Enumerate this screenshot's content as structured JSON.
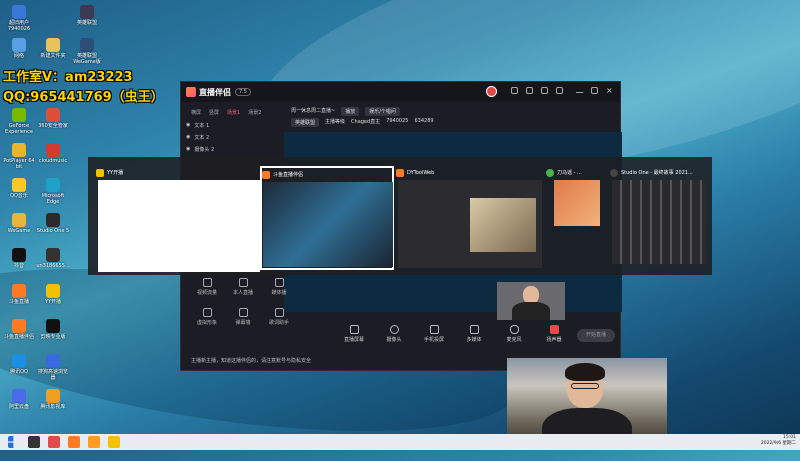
{
  "watermark": {
    "line1": "工作室V：am23223",
    "line2": "QQ:965441769（虫王）"
  },
  "desktop": {
    "icons": [
      {
        "label": "超旧用户\n7940026",
        "color": "#3a78d8"
      },
      {
        "label": "网络",
        "color": "#5aa0e6"
      },
      {
        "label": "新建文件夹",
        "color": "#e8c25a"
      },
      {
        "label": "英雄联盟",
        "color": "#3a3a55"
      },
      {
        "label": "英雄联盟 WeGame版",
        "color": "#2c4f7a"
      },
      {
        "label": "GeForce Experience",
        "color": "#76b900"
      },
      {
        "label": "360安全管家",
        "color": "#e04e3a"
      },
      {
        "label": "PotPlayer 64 bit",
        "color": "#e8b52c"
      },
      {
        "label": "cloudmusic",
        "color": "#d33a31"
      },
      {
        "label": "QQ音乐",
        "color": "#f6c82b"
      },
      {
        "label": "Microsoft Edge",
        "color": "#1fa0c8"
      },
      {
        "label": "WeGame",
        "color": "#e9b63a"
      },
      {
        "label": "Studio One 5",
        "color": "#2b2b2b"
      },
      {
        "label": "抖音",
        "color": "#111111"
      },
      {
        "label": "un3186655...",
        "color": "#333"
      },
      {
        "label": "斗鱼直播",
        "color": "#ff7a22"
      },
      {
        "label": "YY开播",
        "color": "#f2c200"
      },
      {
        "label": "斗鱼直播伴侣",
        "color": "#ff7a22"
      },
      {
        "label": "剪映专业版",
        "color": "#111"
      },
      {
        "label": "腾讯QQ",
        "color": "#1a8fe3"
      },
      {
        "label": "搜狗高速浏览器",
        "color": "#3a6ae0"
      },
      {
        "label": "阿里云盘",
        "color": "#4a6ae8"
      },
      {
        "label": "腾讯影视库",
        "color": "#f0a020"
      }
    ]
  },
  "app": {
    "name": "直播伴侣",
    "version": "7.5",
    "scene_tabs": [
      "横屏",
      "竖屏",
      "场景1",
      "场景2"
    ],
    "layers": [
      "文本 1",
      "文本 2",
      "摄像头 2"
    ],
    "live_title": "周一休息周二直播~",
    "live_status": "播放",
    "category": "娱乐/个唱问",
    "tag1": "英雄联盟",
    "tag2": "主播等级",
    "username": "Chaged直主",
    "room": "7940025",
    "fans": "634289",
    "toolbar": [
      "直播屏幕",
      "摄像头",
      "手机投屏",
      "多媒体",
      "麦克风",
      "扬声器"
    ],
    "left_tools": [
      "视频流量",
      "本人直播",
      "媒体播",
      "虚拟形象",
      "弹幕墙",
      "歌词助手"
    ],
    "start_button": "开始直播",
    "notice": "主播新主播，知道这播伴侣的，请注意账号与隐私安全"
  },
  "switcher": {
    "cards": [
      {
        "title": "YY开播",
        "icon_color": "#f2c200"
      },
      {
        "title": "斗鱼直播伴侣",
        "icon_color": "#ff7a22"
      },
      {
        "title": "DYToolWeb",
        "icon_color": "#ff7a22"
      },
      {
        "title": "刀马谣 - ...",
        "icon_color": "#4ab34a"
      },
      {
        "title": "Studio One - 最终故事 2021...",
        "icon_color": "#2b2b2b"
      }
    ]
  },
  "tray": {
    "time": "15:01",
    "date": "2022/9/6 星期二"
  }
}
